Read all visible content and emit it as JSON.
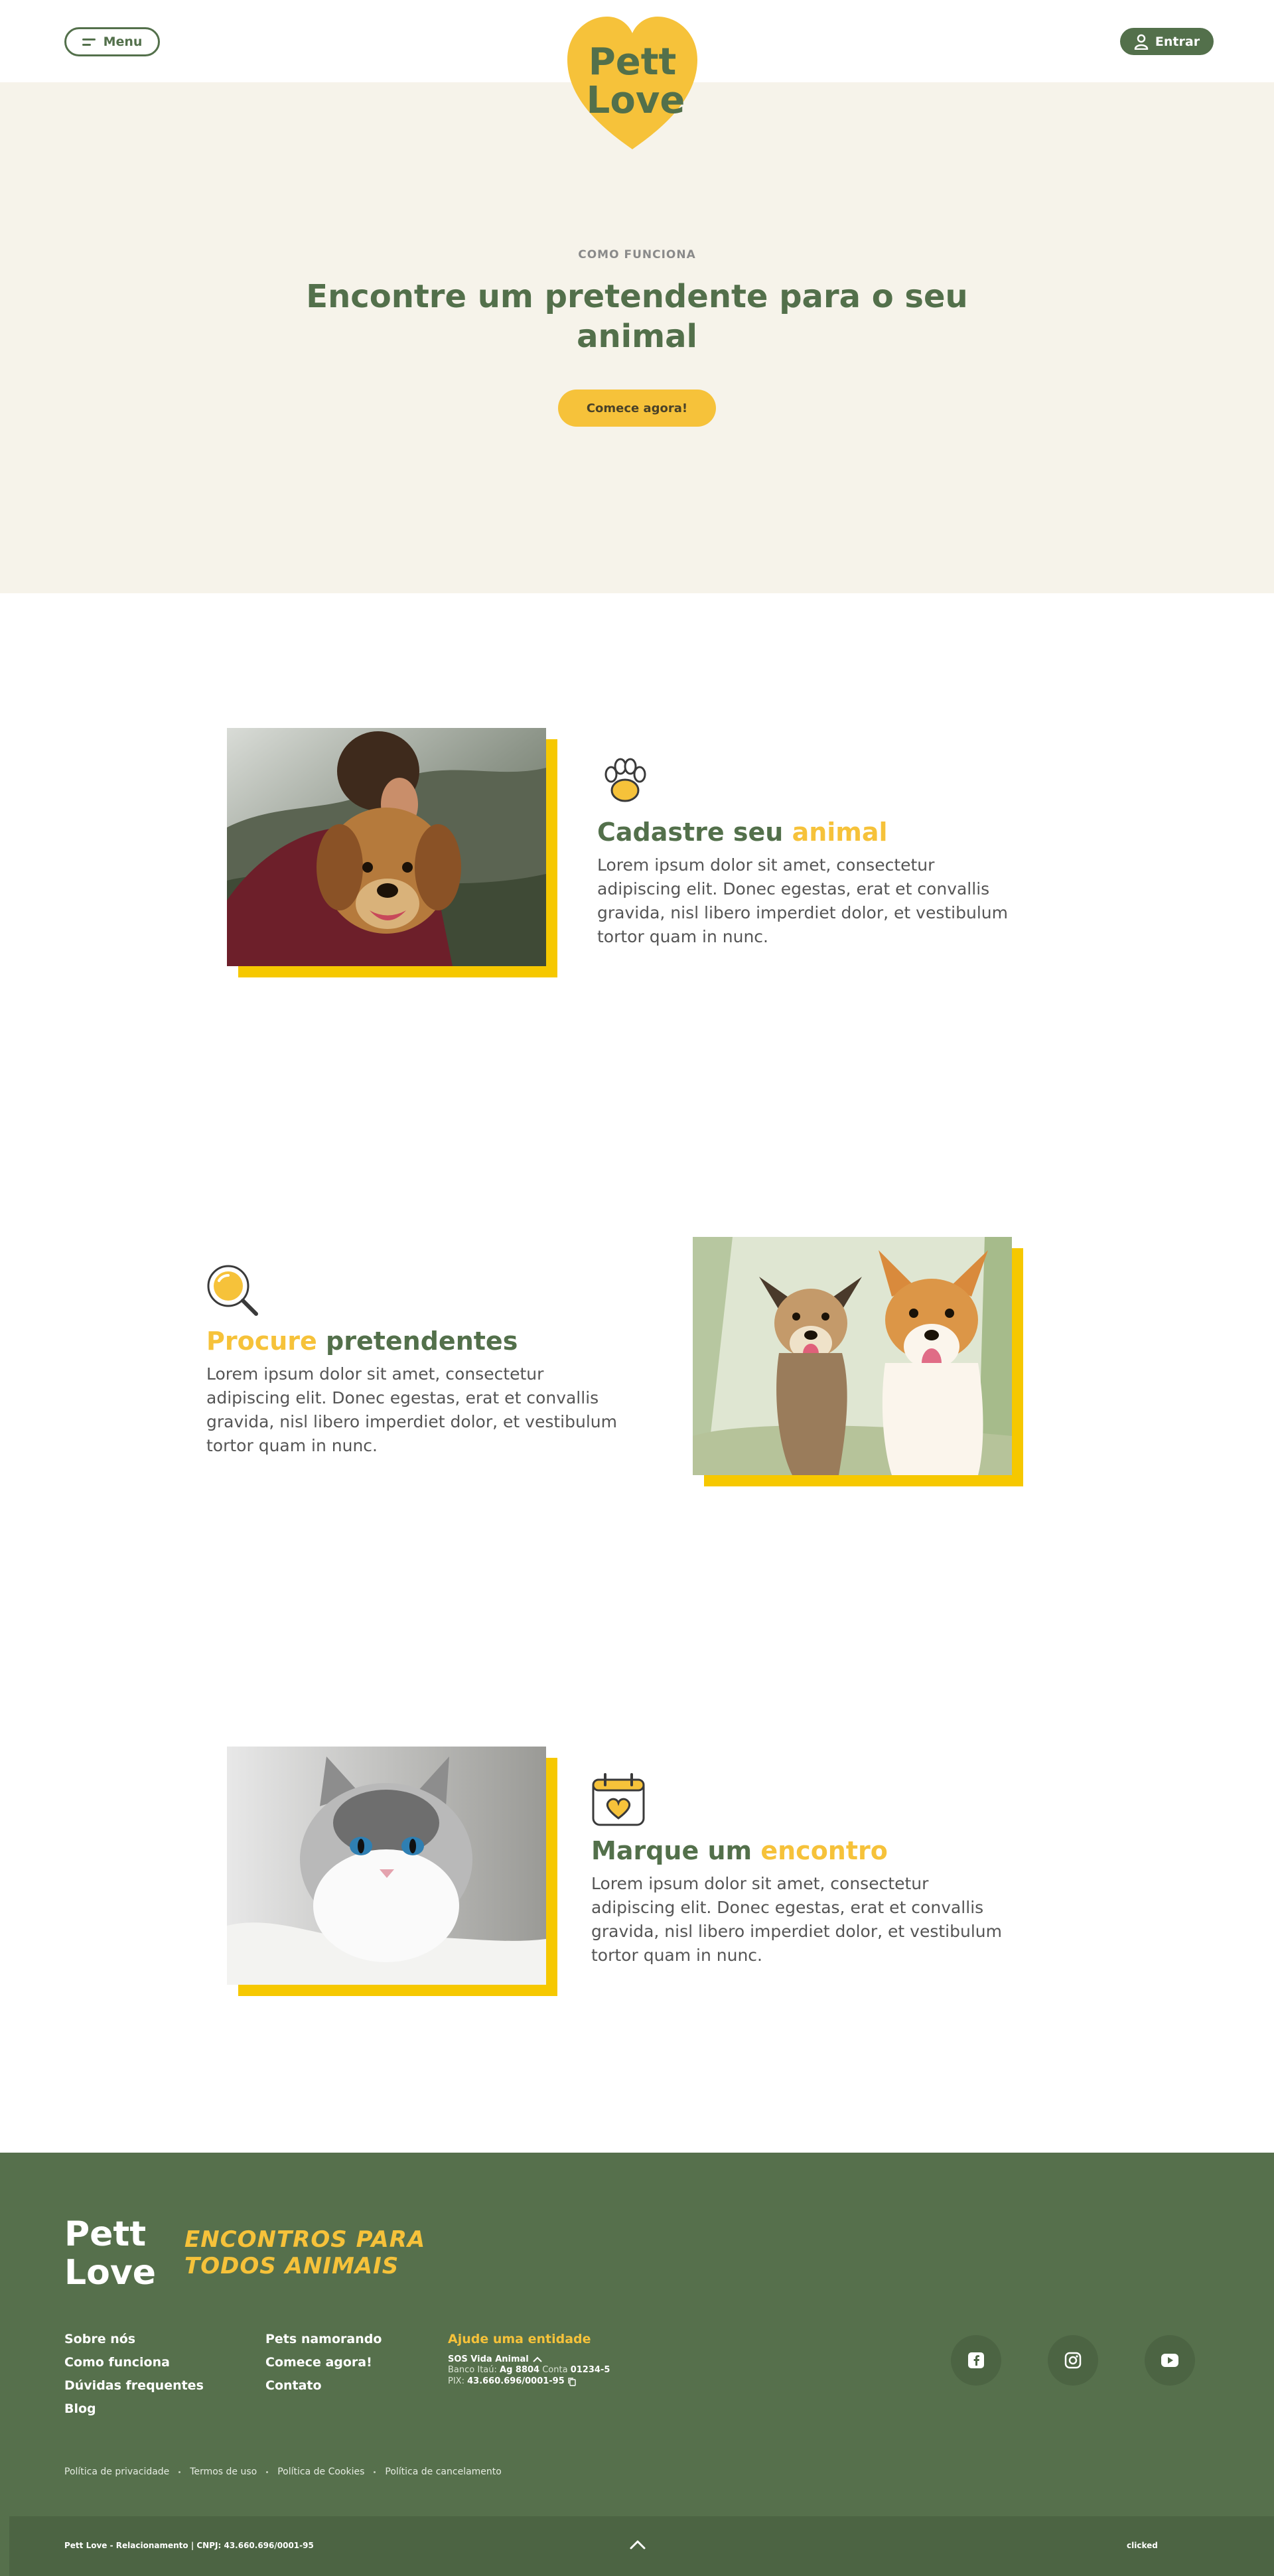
{
  "header": {
    "menu_label": "Menu",
    "login_label": "Entrar",
    "logo_text_line1": "Pett",
    "logo_text_line2": "Love"
  },
  "hero": {
    "eyebrow": "COMO FUNCIONA",
    "title": "Encontre um pretendente para o seu animal",
    "cta_label": "Comece agora!"
  },
  "steps": [
    {
      "title_main": "Cadastre seu",
      "title_accent": "animal",
      "text": "Lorem ipsum dolor sit amet, consectetur adipiscing elit. Donec egestas, erat et convallis gravida, nisl libero imperdiet dolor, et vestibulum tortor quam in nunc.",
      "icon": "paw-icon",
      "photo": "man-hugging-dog-photo"
    },
    {
      "title_accent": "Procure",
      "title_main": "pretendentes",
      "text": "Lorem ipsum dolor sit amet, consectetur adipiscing elit. Donec egestas, erat et convallis gravida, nisl libero imperdiet dolor, et vestibulum tortor quam in nunc.",
      "icon": "magnifier-icon",
      "photo": "two-dogs-photo"
    },
    {
      "title_main": "Marque um",
      "title_accent": "encontro",
      "text": "Lorem ipsum dolor sit amet, consectetur adipiscing elit. Donec egestas, erat et convallis gravida, nisl libero imperdiet dolor, et vestibulum tortor quam in nunc.",
      "icon": "calendar-heart-icon",
      "photo": "fluffy-cat-photo"
    }
  ],
  "footer": {
    "slogan_line1": "ENCONTROS PARA",
    "slogan_line2": "TODOS ANIMAIS",
    "col1": [
      "Sobre nós",
      "Como funciona",
      "Dúvidas frequentes",
      "Blog"
    ],
    "col2": [
      "Pets namorando",
      "Comece agora!",
      "Contato"
    ],
    "donate": {
      "title": "Ajude uma entidade",
      "org": "SOS Vida Animal",
      "bank_label": "Banco Itaú:",
      "bank_agency": "Ag 8804",
      "account_label": "Conta",
      "account": "01234-5",
      "pix_label": "PIX:",
      "pix": "43.660.696/0001-95"
    },
    "socials": [
      "facebook-icon",
      "instagram-icon",
      "youtube-icon"
    ],
    "legal": [
      "Política de privacidade",
      "Termos de uso",
      "Política de Cookies",
      "Política de cancelamento"
    ],
    "copyright": "Pett Love - Relacionamento | CNPJ: 43.660.696/0001-95",
    "made_by": "clicked"
  },
  "colors": {
    "brand_green": "#53704b",
    "brand_yellow": "#f6c23a",
    "hero_bg": "#f6f3ea",
    "footer_bg": "#56704c"
  }
}
